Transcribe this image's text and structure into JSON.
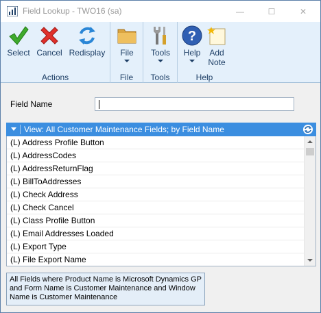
{
  "window": {
    "title": "Field Lookup  -  TWO16 (sa)",
    "minimize_glyph": "—",
    "maximize_glyph": "☐",
    "close_glyph": "✕"
  },
  "ribbon": {
    "groups": [
      {
        "label": "Actions",
        "buttons": [
          {
            "label": "Select",
            "icon": "green-checkmark-icon"
          },
          {
            "label": "Cancel",
            "icon": "red-x-icon"
          },
          {
            "label": "Redisplay",
            "icon": "refresh-arrows-icon"
          }
        ]
      },
      {
        "label": "File",
        "buttons": [
          {
            "label": "File",
            "icon": "folder-icon"
          }
        ]
      },
      {
        "label": "Tools",
        "buttons": [
          {
            "label": "Tools",
            "icon": "tools-icon"
          }
        ]
      },
      {
        "label": "Help",
        "buttons": [
          {
            "label": "Help",
            "icon": "help-question-icon"
          },
          {
            "label_line1": "Add",
            "label_line2": "Note",
            "icon": "add-note-icon"
          }
        ]
      }
    ]
  },
  "field": {
    "label": "Field Name",
    "value": ""
  },
  "view": {
    "label": "View: All Customer Maintenance Fields; by Field Name"
  },
  "list": {
    "rows": [
      "(L) Address Profile Button",
      "(L) AddressCodes",
      "(L) AddressReturnFlag",
      "(L) BillToAddresses",
      "(L) Check Address",
      "(L) Check Cancel",
      "(L) Class Profile Button",
      "(L) Email Addresses Loaded",
      "(L) Export Type",
      "(L) File Export Name"
    ]
  },
  "description": "All Fields where Product Name is Microsoft Dynamics GP and Form Name is Customer Maintenance and Window Name is Customer Maintenance",
  "colors": {
    "ribbon_bg": "#e4f0fb",
    "view_header_bg": "#3b8ee0",
    "ribbon_text": "#1e3f66"
  }
}
